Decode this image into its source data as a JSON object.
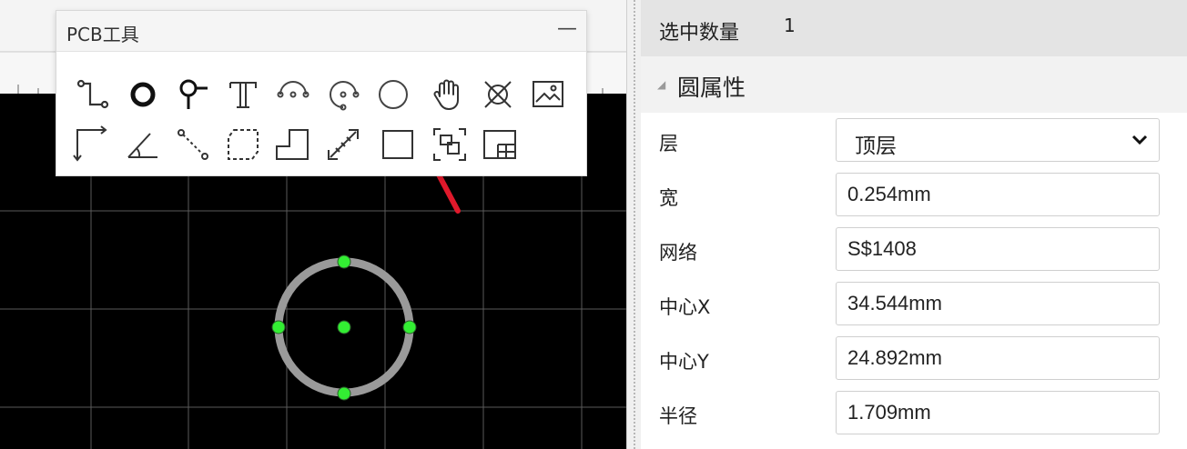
{
  "tool_window": {
    "title": "PCB工具",
    "minimize_glyph": "—",
    "tools_row1": [
      "track-icon",
      "pad-icon",
      "via-icon",
      "text-icon",
      "arc-icon",
      "center-arc-icon",
      "circle-icon",
      "pan-hand-icon",
      "hole-icon",
      "image-icon"
    ],
    "tools_row2": [
      "dimension-icon",
      "protractor-icon",
      "connect-pads-icon",
      "copper-area-icon",
      "solid-region-icon",
      "measure-icon",
      "rectangle-icon",
      "group-icon",
      "panel-icon"
    ]
  },
  "panel": {
    "selected_count_label": "选中数量",
    "selected_count_value": "1",
    "section_title": "圆属性",
    "fields": {
      "layer_label": "层",
      "layer_value": "顶层",
      "width_label": "宽",
      "width_value": "0.254mm",
      "net_label": "网络",
      "net_value": "S$1408",
      "center_x_label": "中心X",
      "center_x_value": "34.544mm",
      "center_y_label": "中心Y",
      "center_y_value": "24.892mm",
      "radius_label": "半径",
      "radius_value": "1.709mm"
    }
  },
  "colors": {
    "canvas_bg": "#000000",
    "grid_line": "#5a5a5a",
    "circle_stroke": "#9a9a9a",
    "handle_fill": "#33ee33",
    "arrow_annotation": "#e0192b"
  }
}
